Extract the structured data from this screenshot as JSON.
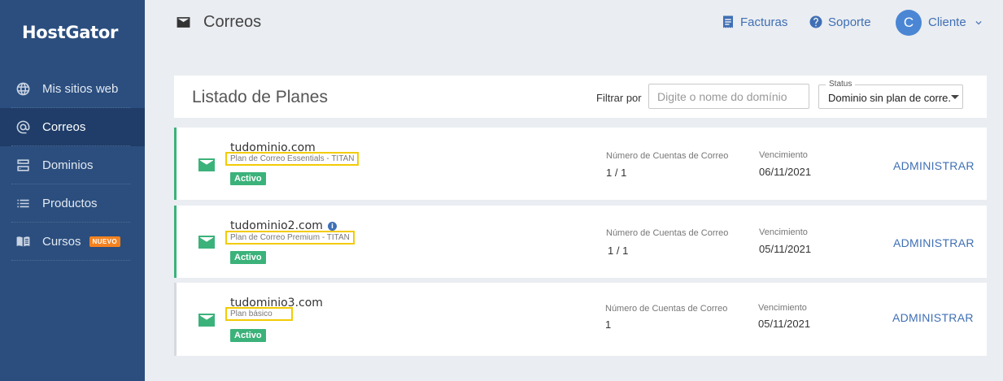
{
  "brand": {
    "logo": "HostGator"
  },
  "sidebar": {
    "items": [
      {
        "label": "Mis sitios web",
        "icon": "globe-icon",
        "active": false
      },
      {
        "label": "Correos",
        "icon": "at-sign-icon",
        "active": true
      },
      {
        "label": "Dominios",
        "icon": "server-icon",
        "active": false
      },
      {
        "label": "Productos",
        "icon": "list-icon",
        "active": false
      },
      {
        "label": "Cursos",
        "icon": "book-icon",
        "active": false,
        "badge": "NUEVO"
      }
    ]
  },
  "header": {
    "title": "Correos",
    "title_icon": "envelope-icon",
    "invoices": "Facturas",
    "support": "Soporte",
    "avatar_initial": "C",
    "client": "Cliente"
  },
  "listing": {
    "title": "Listado de Planes",
    "filter_label": "Filtrar por",
    "filter_placeholder": "Digite o nome do domínio",
    "filter_value": "",
    "status_legend": "Status",
    "status_value": "Dominio sin plan de corre..."
  },
  "plans": [
    {
      "domain": "tudominio.com",
      "plan": "Plan de Correo Essentials - TITAN",
      "status": "Activo",
      "accounts_label": "Número de Cuentas de Correo",
      "accounts": "1 / 1",
      "expiry_label": "Vencimiento",
      "expiry": "06/11/2021",
      "action": "ADMINISTRAR",
      "has_info": false
    },
    {
      "domain": "tudominio2.com",
      "plan": "Plan de Correo Premium - TITAN",
      "status": "Activo",
      "accounts_label": "Número de Cuentas de Correo",
      "accounts": "1 / 1",
      "expiry_label": "Vencimiento",
      "expiry": "05/11/2021",
      "action": "ADMINISTRAR",
      "has_info": true
    },
    {
      "domain": "tudominio3.com",
      "plan": "Plan básico",
      "status": "Activo",
      "accounts_label": "Número de Cuentas de Correo",
      "accounts": "1",
      "expiry_label": "Vencimiento",
      "expiry": "05/11/2021",
      "action": "ADMINISTRAR",
      "has_info": false
    }
  ],
  "colors": {
    "sidebar": "#2b4e7e",
    "sidebar_active": "#1f3d68",
    "accent": "#3f6fb5",
    "active_green": "#3bb27a",
    "highlight": "#f2cb05",
    "badge_new": "#f58220"
  }
}
